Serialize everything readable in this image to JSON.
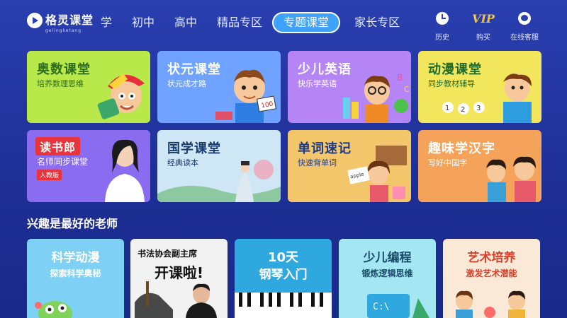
{
  "header": {
    "logo_text": "格灵课堂",
    "logo_sub": "gelingketang",
    "nav": [
      "学",
      "初中",
      "高中",
      "精品专区",
      "专题课堂",
      "家长专区"
    ],
    "active_nav": "专题课堂",
    "tools": [
      {
        "label": "历史",
        "icon": "clock-icon"
      },
      {
        "label": "购买",
        "icon": "vip-icon",
        "text": "VIP"
      },
      {
        "label": "在线客服",
        "icon": "customer-service-icon"
      }
    ]
  },
  "cards": [
    {
      "title": "奥数课堂",
      "sub": "培养数理思维",
      "bg": "#b9e84a",
      "fg": "#2d6e1c"
    },
    {
      "title": "状元课堂",
      "sub": "状元成才路",
      "bg": "#6fa3ff",
      "fg": "#ffffff"
    },
    {
      "title": "少儿英语",
      "sub": "快乐学英语",
      "bg": "#b685f5",
      "fg": "#ffffff"
    },
    {
      "title": "动漫课堂",
      "sub": "同步教材辅导",
      "bg": "#f2e65c",
      "fg": "#1f6b2b"
    },
    {
      "title": "读书郎",
      "sub": "名师同步课堂",
      "badge": "人教版",
      "bg": "#8a6cf0",
      "fg": "#ffffff"
    },
    {
      "title": "国学课堂",
      "sub": "经典读本",
      "bg": "#cfe6f5",
      "fg": "#1a3b6e"
    },
    {
      "title": "单词速记",
      "sub": "快速背单词",
      "bg": "#f4c66b",
      "fg": "#1a3b8a"
    },
    {
      "title": "趣味学汉字",
      "sub": "写好中国字",
      "bg": "#f5a35a",
      "fg": "#ffffff"
    }
  ],
  "section": {
    "title": "兴趣是最好的老师"
  },
  "interest": [
    {
      "title": "科学动漫",
      "sub": "探索科学奥秘",
      "bg": "#7fd0f5",
      "fg": "#ffffff"
    },
    {
      "title": "开课啦!",
      "pre": "书法协会副主席",
      "bg": "#f2f2f2",
      "fg": "#111111"
    },
    {
      "title": "10天",
      "sub": "钢琴入门",
      "bg": "#2fa8e0",
      "fg": "#ffffff"
    },
    {
      "title": "少儿编程",
      "sub": "锻炼逻辑思维",
      "bg": "#a4e6f2",
      "fg": "#1a4a6a"
    },
    {
      "title": "艺术培养",
      "sub": "激发艺术潜能",
      "bg": "#fbe9d8",
      "fg": "#d9402c"
    }
  ]
}
